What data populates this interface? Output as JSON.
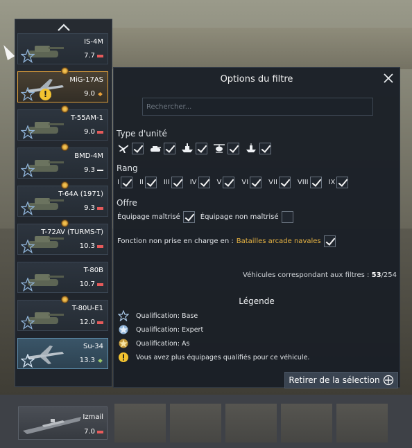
{
  "vehicles": [
    {
      "name": "IS-4M",
      "br": "7.7",
      "kind": "tank",
      "mode": "ground",
      "state": "normal",
      "dot": false
    },
    {
      "name": "MiG-17AS",
      "br": "9.0",
      "kind": "plane",
      "mode": "air",
      "state": "orange",
      "dot": true,
      "warning": "!"
    },
    {
      "name": "T-55AM-1",
      "br": "9.0",
      "kind": "tank",
      "mode": "ground",
      "state": "normal",
      "dot": true
    },
    {
      "name": "BMD-4M",
      "br": "9.3",
      "kind": "tank",
      "mode": "heli",
      "state": "normal",
      "dot": true
    },
    {
      "name": "T-64A (1971)",
      "br": "9.3",
      "kind": "tank",
      "mode": "ground",
      "state": "normal",
      "dot": true
    },
    {
      "name": "T-72AV (TURMS-T)",
      "br": "10.3",
      "kind": "tank",
      "mode": "ground",
      "state": "normal",
      "dot": true
    },
    {
      "name": "T-80B",
      "br": "10.7",
      "kind": "tank",
      "mode": "ground",
      "state": "normal",
      "dot": false
    },
    {
      "name": "T-80U-E1",
      "br": "12.0",
      "kind": "tank",
      "mode": "ground",
      "state": "normal",
      "dot": true
    },
    {
      "name": "Su-34",
      "br": "13.3",
      "kind": "plane",
      "mode": "air-green",
      "state": "blue",
      "dot": false
    }
  ],
  "bottom_vehicle": {
    "name": "Izmail",
    "br": "7.0"
  },
  "filter": {
    "title": "Options du filtre",
    "search_placeholder": "Rechercher...",
    "unit_type_label": "Type d'unité",
    "unit_types": [
      "plane-icon",
      "tank-icon",
      "ship-icon",
      "heli-icon",
      "boat-icon"
    ],
    "rank_label": "Rang",
    "ranks": [
      "I",
      "II",
      "III",
      "IV",
      "V",
      "VI",
      "VII",
      "VIII",
      "IX"
    ],
    "offer_label": "Offre",
    "crew_mastered": "Équipage maîtrisé",
    "crew_not_mastered": "Équipage non maîtrisé",
    "unsupported_prefix": "Fonction non prise en charge en :",
    "unsupported_mode": "Batailles arcade navales",
    "count_prefix": "Véhicules correspondant aux filtres :",
    "count_match": "53",
    "count_total": "/254",
    "legend_title": "Légende",
    "legend": [
      {
        "icon": "basic-qualification-icon",
        "text": "Qualification: Base"
      },
      {
        "icon": "expert-qualification-icon",
        "text": "Qualification: Expert"
      },
      {
        "icon": "ace-qualification-icon",
        "text": "Qualification: As"
      },
      {
        "icon": "warning-icon",
        "text": "Vous avez plus équipages qualifiés pour ce véhicule."
      }
    ],
    "remove_button": "Retirer de la sélection"
  },
  "colors": {
    "accent_gold": "#e8b443",
    "selected_orange": "#e5a33b",
    "selected_blue": "#5f8fae",
    "warning": "#f2c230"
  }
}
